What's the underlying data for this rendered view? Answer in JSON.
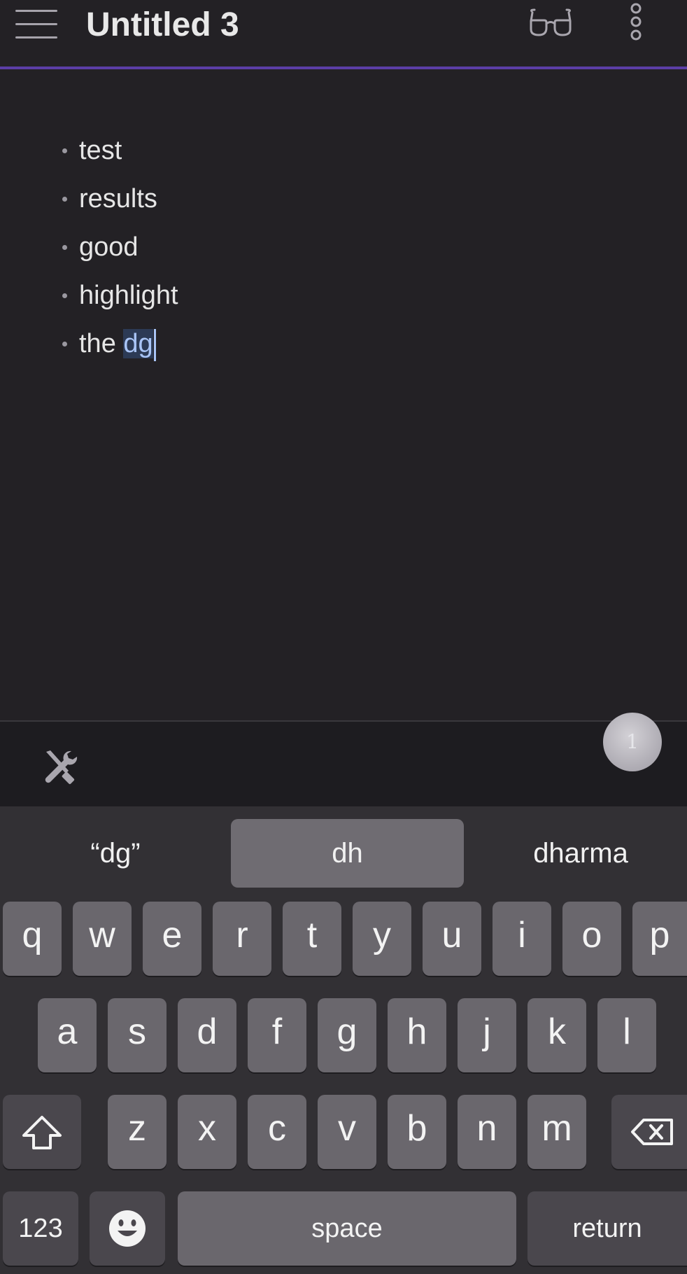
{
  "header": {
    "title": "Untitled 3"
  },
  "editor": {
    "items": [
      "test",
      "results",
      "good",
      "highlight"
    ],
    "last_item_prefix": "the ",
    "last_item_selected": "dg"
  },
  "toolbar": {
    "badge_count": "1"
  },
  "keyboard": {
    "suggestions": [
      "“dg”",
      "dh",
      "dharma"
    ],
    "row1": [
      "q",
      "w",
      "e",
      "r",
      "t",
      "y",
      "u",
      "i",
      "o",
      "p"
    ],
    "row2": [
      "a",
      "s",
      "d",
      "f",
      "g",
      "h",
      "j",
      "k",
      "l"
    ],
    "row3": [
      "z",
      "x",
      "c",
      "v",
      "b",
      "n",
      "m"
    ],
    "numbers_label": "123",
    "space_label": "space",
    "return_label": "return"
  },
  "colors": {
    "accent_line": "#5b3ea6",
    "selection": "#2c3a55",
    "background": "#232125"
  }
}
